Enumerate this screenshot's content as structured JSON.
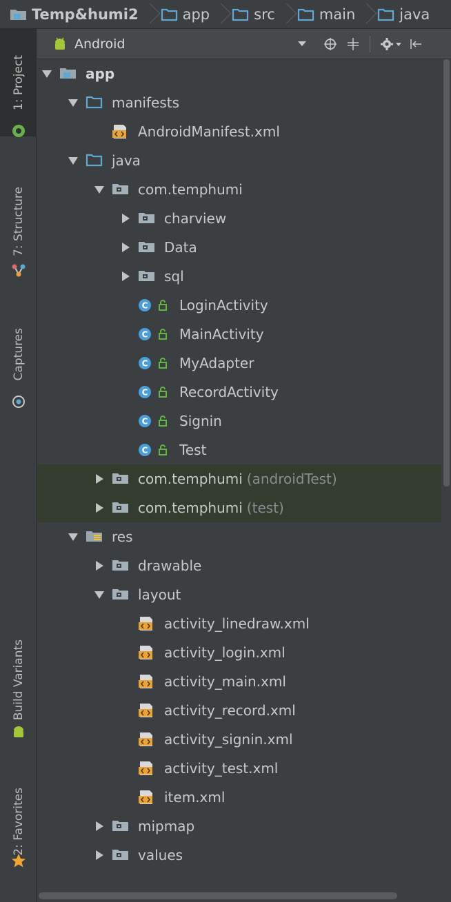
{
  "breadcrumb": [
    "Temp&humi2",
    "app",
    "src",
    "main",
    "java"
  ],
  "toolwindows": {
    "project": "1: Project",
    "structure": "7: Structure",
    "captures": "Captures",
    "build_variants": "Build Variants",
    "favorites": "2: Favorites"
  },
  "panel": {
    "view_mode": "Android"
  },
  "tree": [
    {
      "level": 0,
      "arrow": "open",
      "icon": "module-folder-icon",
      "label": "app",
      "bold": true
    },
    {
      "level": 1,
      "arrow": "open",
      "icon": "folder-icon",
      "label": "manifests"
    },
    {
      "level": 2,
      "arrow": "",
      "icon": "xml-file-icon",
      "label": "AndroidManifest.xml"
    },
    {
      "level": 1,
      "arrow": "open",
      "icon": "folder-icon",
      "label": "java"
    },
    {
      "level": 2,
      "arrow": "open",
      "icon": "package-icon",
      "label": "com.temphumi"
    },
    {
      "level": 3,
      "arrow": "closed",
      "icon": "package-icon",
      "label": "charview"
    },
    {
      "level": 3,
      "arrow": "closed",
      "icon": "package-icon",
      "label": "Data"
    },
    {
      "level": 3,
      "arrow": "closed",
      "icon": "package-icon",
      "label": "sql"
    },
    {
      "level": 3,
      "arrow": "",
      "icon": "class-icon",
      "label": "LoginActivity"
    },
    {
      "level": 3,
      "arrow": "",
      "icon": "class-icon",
      "label": "MainActivity"
    },
    {
      "level": 3,
      "arrow": "",
      "icon": "class-icon",
      "label": "MyAdapter"
    },
    {
      "level": 3,
      "arrow": "",
      "icon": "class-icon",
      "label": "RecordActivity"
    },
    {
      "level": 3,
      "arrow": "",
      "icon": "class-icon",
      "label": "Signin"
    },
    {
      "level": 3,
      "arrow": "",
      "icon": "class-icon",
      "label": "Test"
    },
    {
      "level": 2,
      "arrow": "closed",
      "icon": "package-icon",
      "label": "com.temphumi",
      "suffix": "(androidTest)",
      "highlight": true
    },
    {
      "level": 2,
      "arrow": "closed",
      "icon": "package-icon",
      "label": "com.temphumi",
      "suffix": "(test)",
      "highlight": true
    },
    {
      "level": 1,
      "arrow": "open",
      "icon": "res-folder-icon",
      "label": "res"
    },
    {
      "level": 2,
      "arrow": "closed",
      "icon": "package-icon",
      "label": "drawable"
    },
    {
      "level": 2,
      "arrow": "open",
      "icon": "package-icon",
      "label": "layout"
    },
    {
      "level": 3,
      "arrow": "",
      "icon": "xml-file-icon",
      "label": "activity_linedraw.xml"
    },
    {
      "level": 3,
      "arrow": "",
      "icon": "xml-file-icon",
      "label": "activity_login.xml"
    },
    {
      "level": 3,
      "arrow": "",
      "icon": "xml-file-icon",
      "label": "activity_main.xml"
    },
    {
      "level": 3,
      "arrow": "",
      "icon": "xml-file-icon",
      "label": "activity_record.xml"
    },
    {
      "level": 3,
      "arrow": "",
      "icon": "xml-file-icon",
      "label": "activity_signin.xml"
    },
    {
      "level": 3,
      "arrow": "",
      "icon": "xml-file-icon",
      "label": "activity_test.xml"
    },
    {
      "level": 3,
      "arrow": "",
      "icon": "xml-file-icon",
      "label": "item.xml"
    },
    {
      "level": 2,
      "arrow": "closed",
      "icon": "package-icon",
      "label": "mipmap"
    },
    {
      "level": 2,
      "arrow": "closed",
      "icon": "package-icon",
      "label": "values"
    }
  ],
  "colors": {
    "background": "#3c3f41",
    "highlight_row": "#333c2f",
    "folder_blue": "#5fa8d3",
    "class_blue": "#4a9fd8",
    "android_green": "#a4c639",
    "lock_green": "#62b543",
    "xml_orange": "#e8a33d"
  }
}
